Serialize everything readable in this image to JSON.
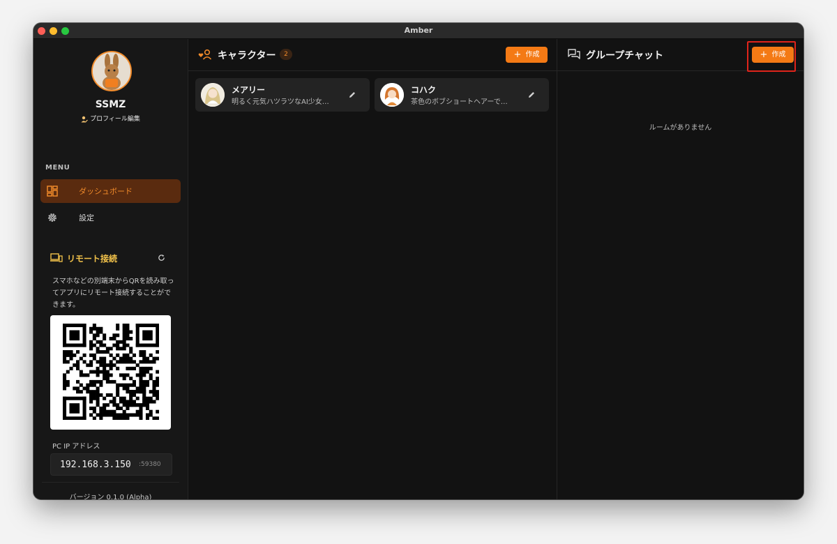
{
  "window": {
    "title": "Amber"
  },
  "colors": {
    "accent": "#f47a15",
    "highlight": "#e0241b",
    "background": "#121212"
  },
  "sidebar": {
    "username": "SSMZ",
    "profile_edit": "プロフィール編集",
    "menu_label": "MENU",
    "menu": [
      {
        "label": "ダッシュボード",
        "icon": "dashboard-icon",
        "active": true
      },
      {
        "label": "設定",
        "icon": "gear-icon",
        "active": false
      }
    ],
    "remote": {
      "title": "リモート接続",
      "description": "スマホなどの別端末からQRを読み取ってアプリにリモート接続することができます。",
      "ip_label": "PC IP アドレス",
      "ip": "192.168.3.150",
      "port": ":59380"
    },
    "version": "バージョン 0.1.0 (Alpha)"
  },
  "characters": {
    "title": "キャラクター",
    "count": "2",
    "create_label": "作成",
    "items": [
      {
        "name": "メアリー",
        "description": "明るく元気ハツラツなAI少女…"
      },
      {
        "name": "コハク",
        "description": "茶色のボブショートヘアーで…"
      }
    ]
  },
  "group_chat": {
    "title": "グループチャット",
    "create_label": "作成",
    "empty_message": "ルームがありません"
  }
}
